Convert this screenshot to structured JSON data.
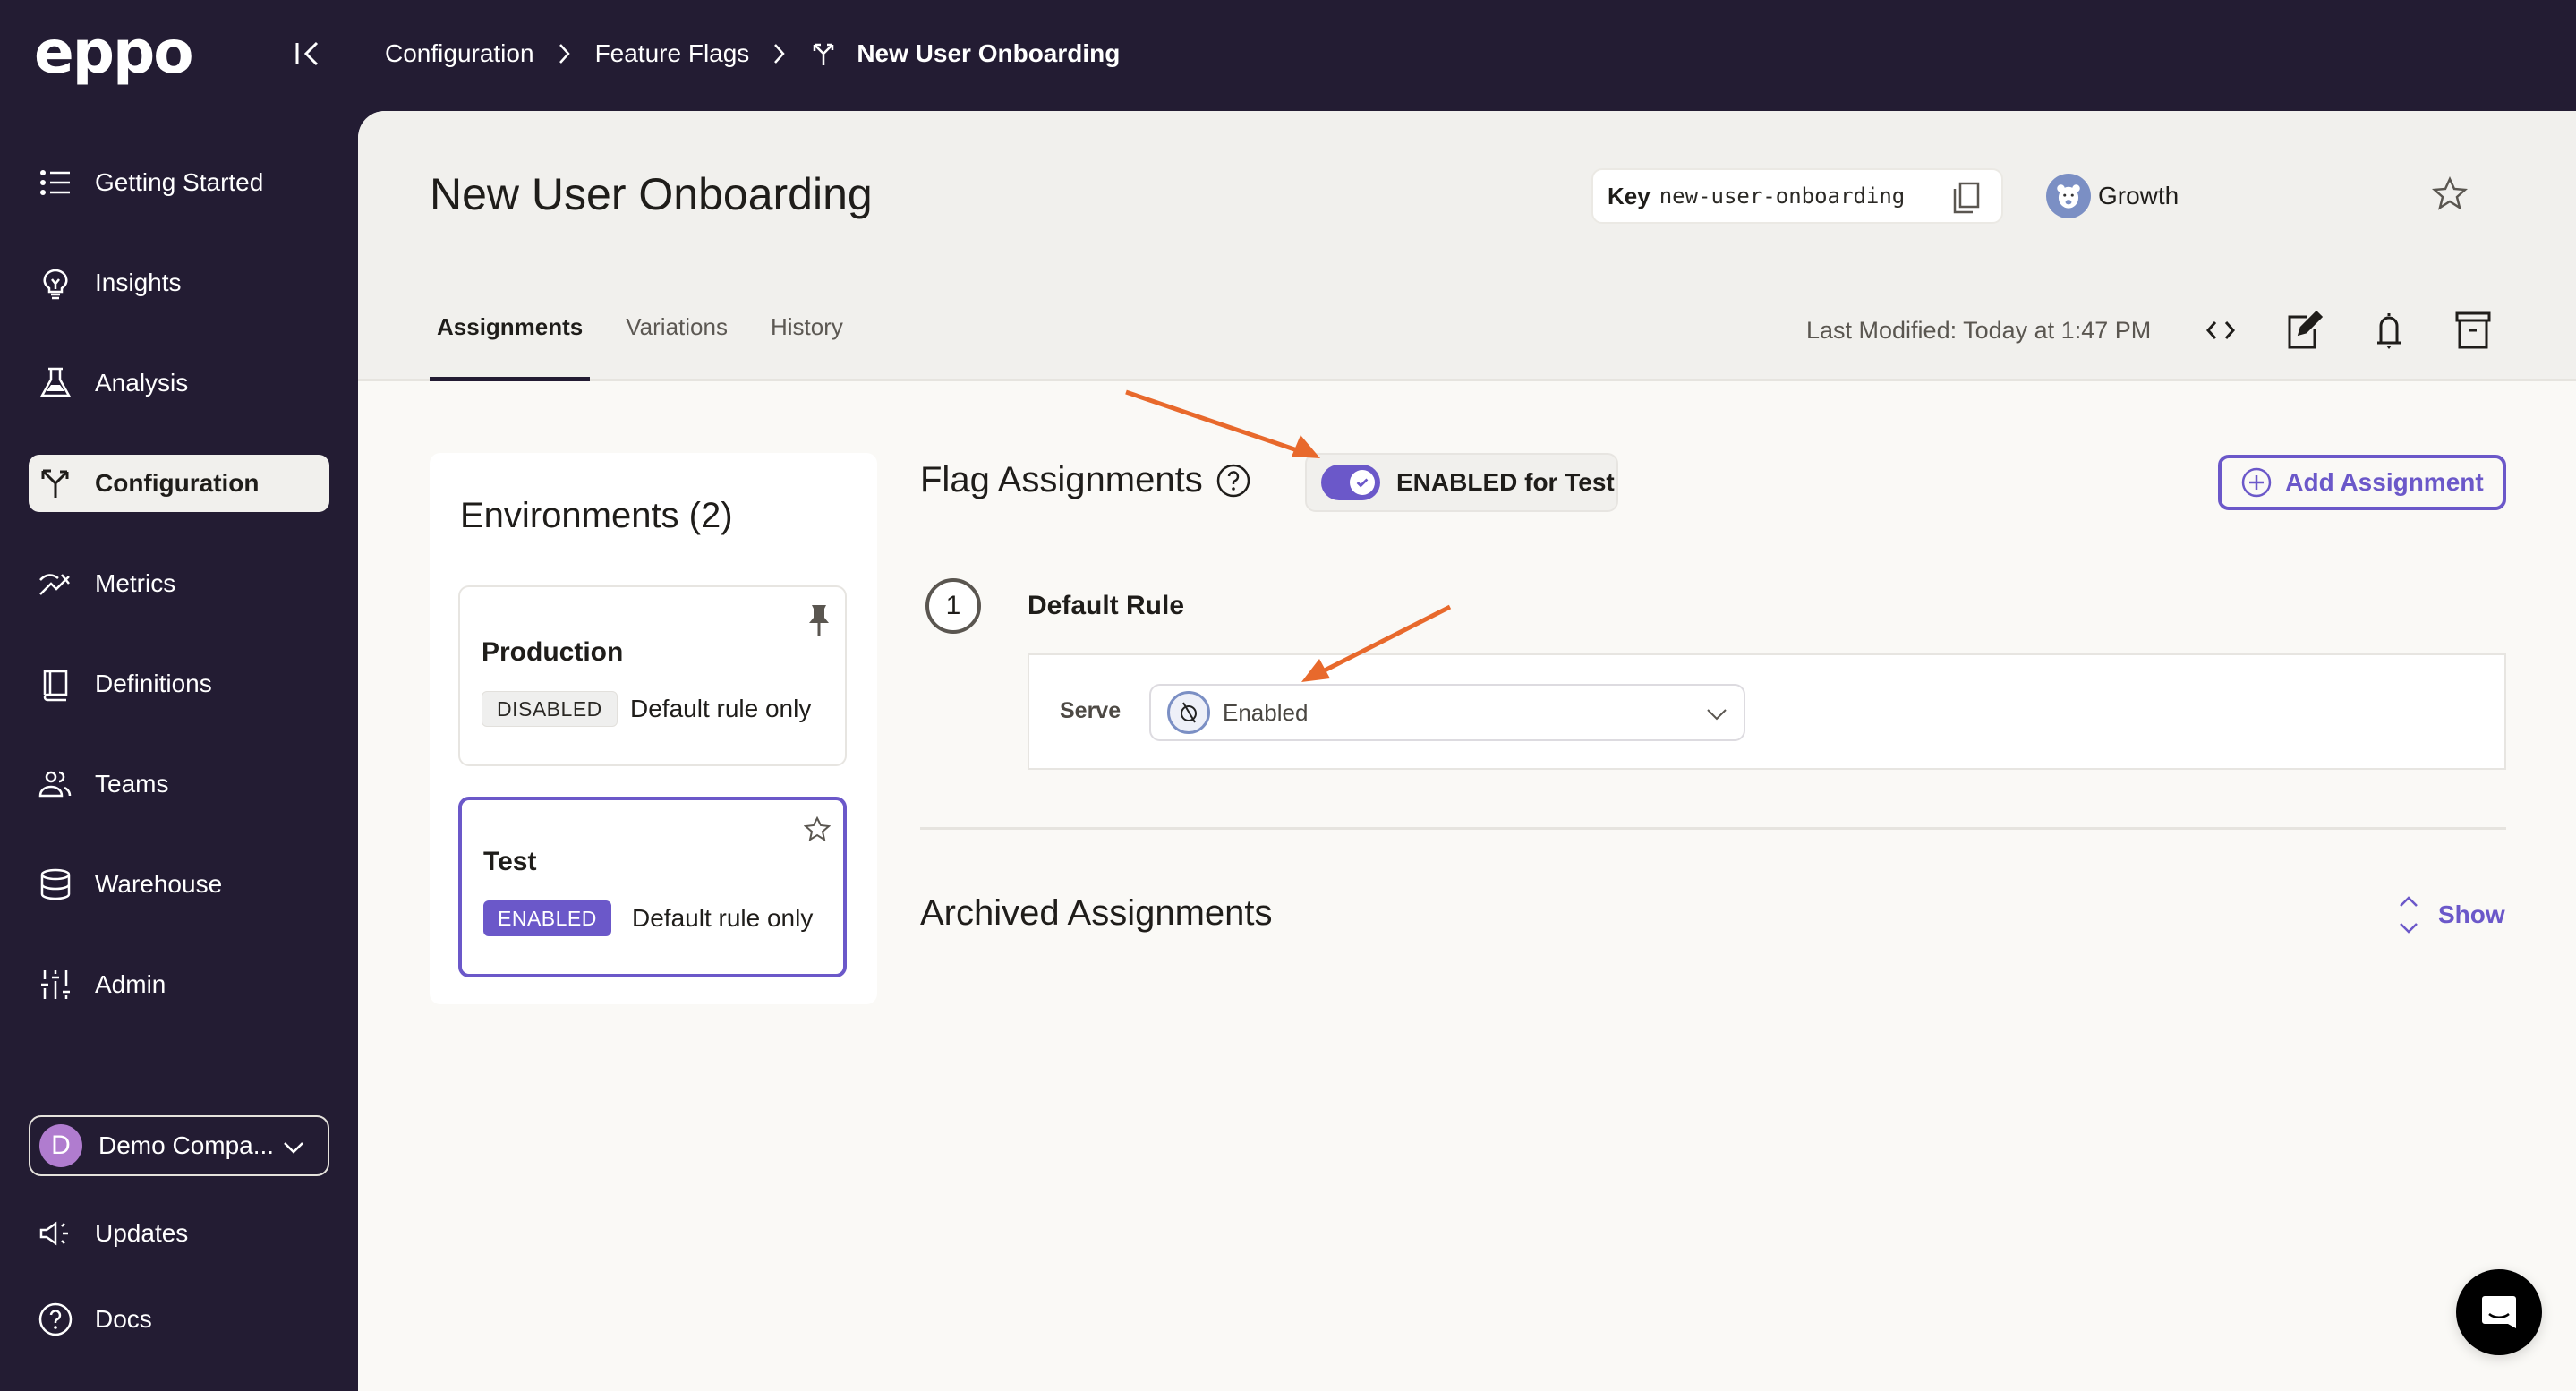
{
  "app": {
    "logo": "eppo"
  },
  "breadcrumb": {
    "items": [
      "Configuration",
      "Feature Flags"
    ],
    "current": "New User Onboarding"
  },
  "sidebar": {
    "items": [
      {
        "label": "Getting Started",
        "icon": "list-icon"
      },
      {
        "label": "Insights",
        "icon": "lightbulb-icon"
      },
      {
        "label": "Analysis",
        "icon": "flask-icon"
      },
      {
        "label": "Configuration",
        "icon": "flag-split-icon",
        "active": true
      },
      {
        "label": "Metrics",
        "icon": "trend-icon"
      },
      {
        "label": "Definitions",
        "icon": "book-icon"
      },
      {
        "label": "Teams",
        "icon": "users-icon"
      },
      {
        "label": "Warehouse",
        "icon": "database-icon"
      },
      {
        "label": "Admin",
        "icon": "sliders-icon"
      }
    ],
    "org": {
      "initial": "D",
      "name": "Demo Compa..."
    },
    "bottom": [
      {
        "label": "Updates",
        "icon": "megaphone-icon"
      },
      {
        "label": "Docs",
        "icon": "help-circle-icon"
      }
    ]
  },
  "header": {
    "title": "New User Onboarding",
    "key_label": "Key",
    "key_value": "new-user-onboarding",
    "team": "Growth",
    "tabs": [
      {
        "label": "Assignments",
        "active": true
      },
      {
        "label": "Variations"
      },
      {
        "label": "History"
      }
    ],
    "last_modified": "Last Modified: Today at 1:47 PM"
  },
  "environments": {
    "title": "Environments (2)",
    "items": [
      {
        "name": "Production",
        "status": "DISABLED",
        "desc": "Default rule only",
        "icon": "pin-icon"
      },
      {
        "name": "Test",
        "status": "ENABLED",
        "desc": "Default rule only",
        "icon": "star-icon",
        "selected": true
      }
    ]
  },
  "assignments": {
    "title": "Flag Assignments",
    "toggle_label": "ENABLED for Test",
    "toggle_on": true,
    "add_label": "Add Assignment",
    "rule_number": "1",
    "rule_title": "Default Rule",
    "serve_label": "Serve",
    "serve_value": "Enabled",
    "archived_title": "Archived Assignments",
    "show_label": "Show"
  },
  "colors": {
    "accent": "#6b58c9",
    "sidebar_bg": "#231c33",
    "annotation_arrow": "#e8692c"
  }
}
